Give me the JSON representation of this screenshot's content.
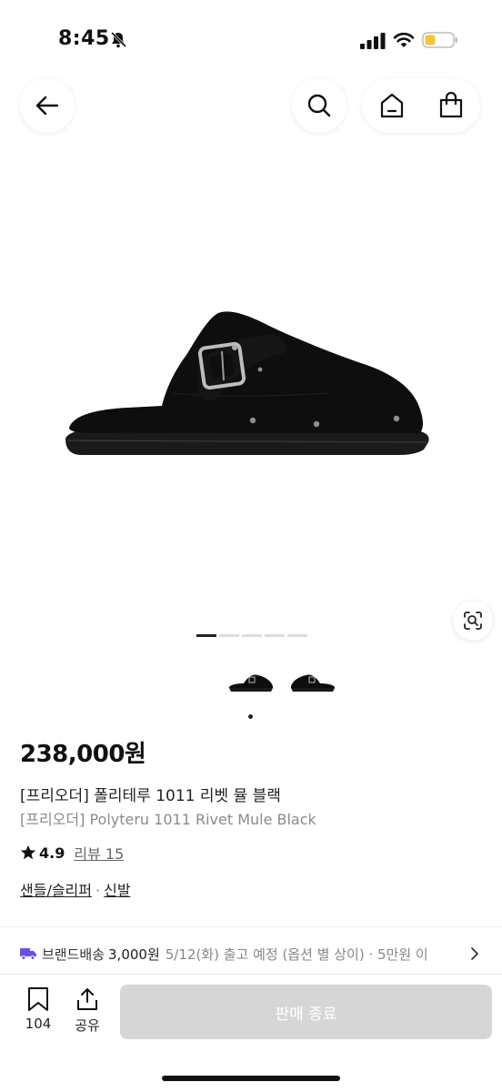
{
  "status_bar": {
    "time": "8:45",
    "icons": [
      "bell-slash-icon",
      "signal-icon",
      "wifi-icon",
      "battery-low-icon"
    ],
    "battery_color": "#f4c431"
  },
  "header": {
    "icons": [
      "back-arrow-icon",
      "search-icon",
      "home-icon",
      "shopping-bag-icon"
    ]
  },
  "gallery": {
    "page_count": 5,
    "active_page": 1,
    "thumbnail_count": 2,
    "lens_icon": "visual-search-icon"
  },
  "product": {
    "price": "238,000원",
    "name_ko": "[프리오더] 폴리테루 1011 리벳 뮬 블랙",
    "name_en": "[프리오더] Polyteru 1011 Rivet Mule Black",
    "rating": "4.9",
    "review_link": "리뷰 15",
    "category_1": "샌들/슬리퍼",
    "category_sep": "·",
    "category_2": "신발"
  },
  "shipping": {
    "icon": "truck-icon",
    "label": "브랜드배송",
    "fee": "3,000원",
    "info": "5/12(화) 출고 예정 (옵션 별 상이) · 5만원 이"
  },
  "bottom_bar": {
    "bookmark_count": "104",
    "share_label": "공유",
    "cta_label": "판매 종료",
    "cta_color": "#d6d6d6"
  }
}
